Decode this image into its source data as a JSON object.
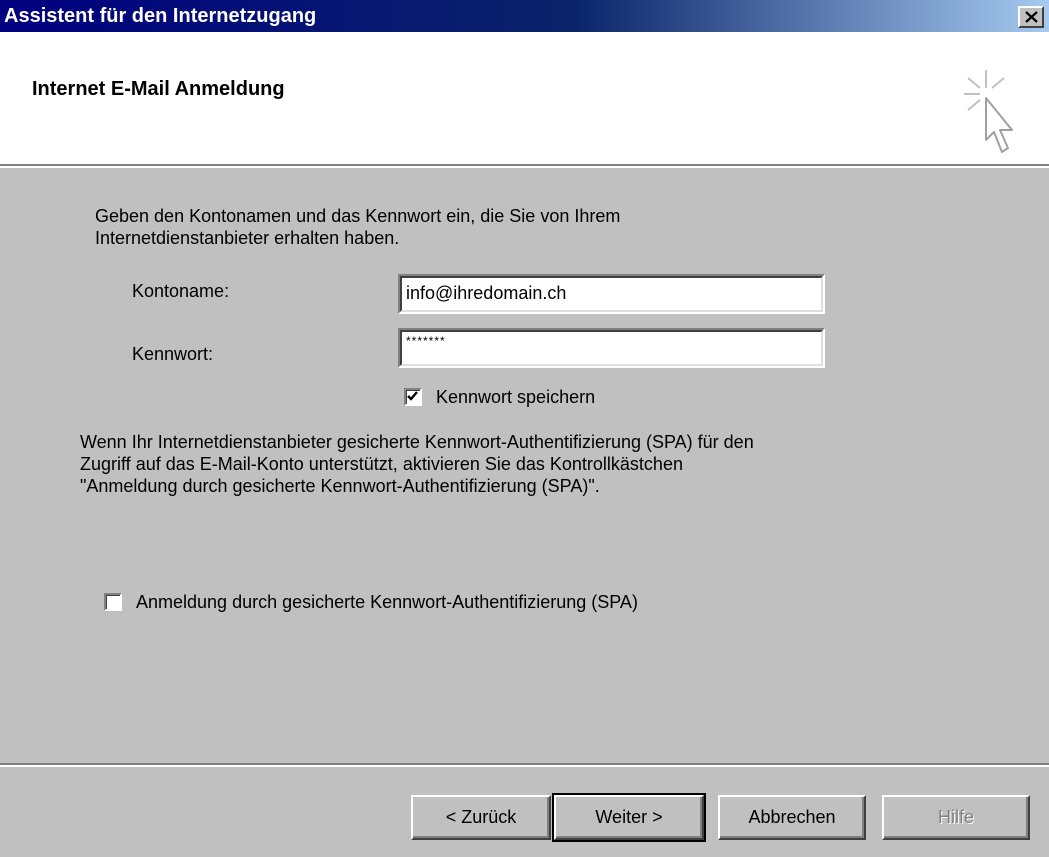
{
  "window": {
    "title": "Assistent für den Internetzugang"
  },
  "header": {
    "heading": "Internet E-Mail Anmeldung"
  },
  "intro": {
    "line1": "Geben den Kontonamen und das Kennwort ein, die Sie von Ihrem",
    "line2": "Internetdienstanbieter erhalten haben."
  },
  "form": {
    "account_label": "Kontoname:",
    "account_value": "info@ihredomain.ch",
    "password_label": "Kennwort:",
    "password_value": "*******",
    "save_password_label": "Kennwort speichern",
    "save_password_checked": true
  },
  "info": {
    "line1": "Wenn Ihr Internetdienstanbieter gesicherte Kennwort-Authentifizierung (SPA) für den",
    "line2": "Zugriff auf das E-Mail-Konto unterstützt, aktivieren Sie das Kontrollkästchen",
    "line3": "\"Anmeldung durch gesicherte Kennwort-Authentifizierung (SPA)\"."
  },
  "spa": {
    "label": "Anmeldung durch gesicherte Kennwort-Authentifizierung (SPA)",
    "checked": false
  },
  "buttons": {
    "back": "< Zurück",
    "next": "Weiter >",
    "cancel": "Abbrechen",
    "help": "Hilfe"
  },
  "icons": {
    "close": "close-icon",
    "wizard": "cursor-sparkle-icon",
    "check": "checkmark-icon"
  }
}
